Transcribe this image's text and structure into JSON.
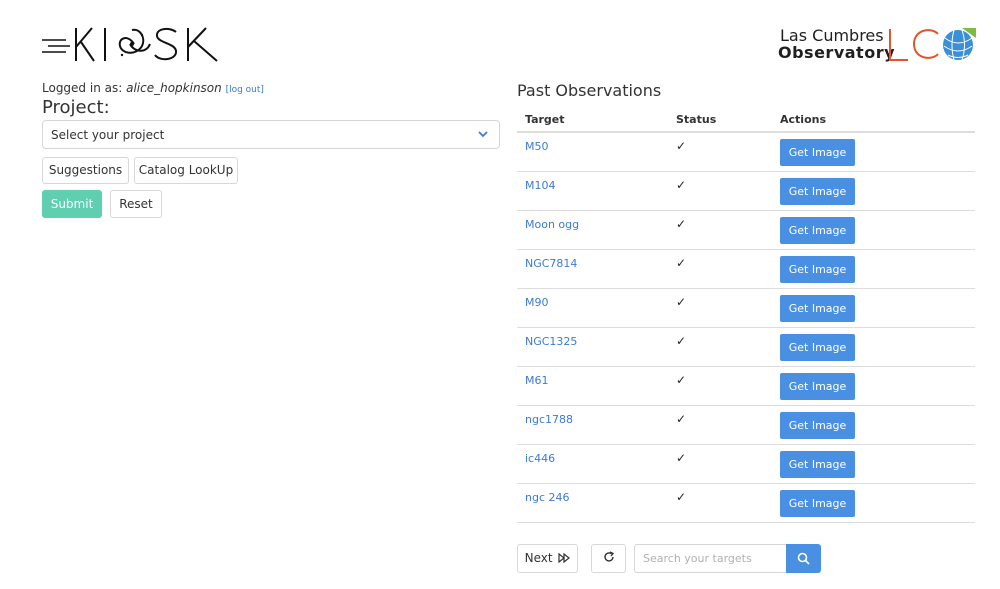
{
  "header": {
    "kiosk_logo_text": "KIOSK",
    "lco_line1": "Las Cumbres",
    "lco_line2": "Observatory",
    "lco_mark": "LCO"
  },
  "login": {
    "prefix": "Logged in as: ",
    "username": "alice_hopkinson",
    "logout": "[log out]"
  },
  "project": {
    "label": "Project:",
    "selected": "Select your project"
  },
  "buttons": {
    "suggestions": "Suggestions",
    "catalog": "Catalog LookUp",
    "submit": "Submit",
    "reset": "Reset",
    "next": "Next"
  },
  "past": {
    "title": "Past Observations",
    "columns": [
      "Target",
      "Status",
      "Actions"
    ],
    "rows": [
      {
        "target": "M50",
        "status": "✓",
        "action": "Get Image"
      },
      {
        "target": "M104",
        "status": "✓",
        "action": "Get Image"
      },
      {
        "target": "Moon ogg",
        "status": "✓",
        "action": "Get Image"
      },
      {
        "target": "NGC7814",
        "status": "✓",
        "action": "Get Image"
      },
      {
        "target": "M90",
        "status": "✓",
        "action": "Get Image"
      },
      {
        "target": "NGC1325",
        "status": "✓",
        "action": "Get Image"
      },
      {
        "target": "M61",
        "status": "✓",
        "action": "Get Image"
      },
      {
        "target": "ngc1788",
        "status": "✓",
        "action": "Get Image"
      },
      {
        "target": "ic446",
        "status": "✓",
        "action": "Get Image"
      },
      {
        "target": "ngc 246",
        "status": "✓",
        "action": "Get Image"
      }
    ]
  },
  "search": {
    "placeholder": "Search your targets"
  },
  "icons": {
    "next": "fast-forward-icon",
    "refresh": "refresh-icon",
    "search": "search-icon",
    "select": "chevron-down-icon"
  },
  "colors": {
    "submit": "#5fcfb0",
    "primary": "#4a90e2",
    "link": "#3b7bd4",
    "lco_orange": "#e2552a",
    "lco_blue": "#3a8fd6",
    "lco_green": "#7dbb42"
  }
}
